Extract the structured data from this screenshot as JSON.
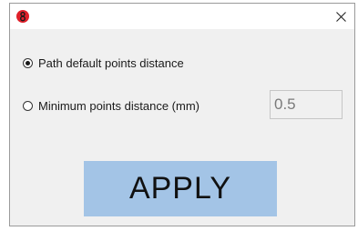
{
  "window": {
    "app_icon": "red-figure-eight-app-icon",
    "close_icon": "close-x-icon"
  },
  "options": [
    {
      "label": "Path default points distance",
      "selected": true
    },
    {
      "label": "Minimum points distance (mm)",
      "selected": false
    }
  ],
  "distance_input": {
    "value": "0.5",
    "enabled": false
  },
  "apply_button": {
    "label": "APPLY"
  },
  "colors": {
    "dialog_background": "#f0f0f0",
    "apply_button": "#a3c4e6",
    "app_icon_red": "#e0202a"
  }
}
